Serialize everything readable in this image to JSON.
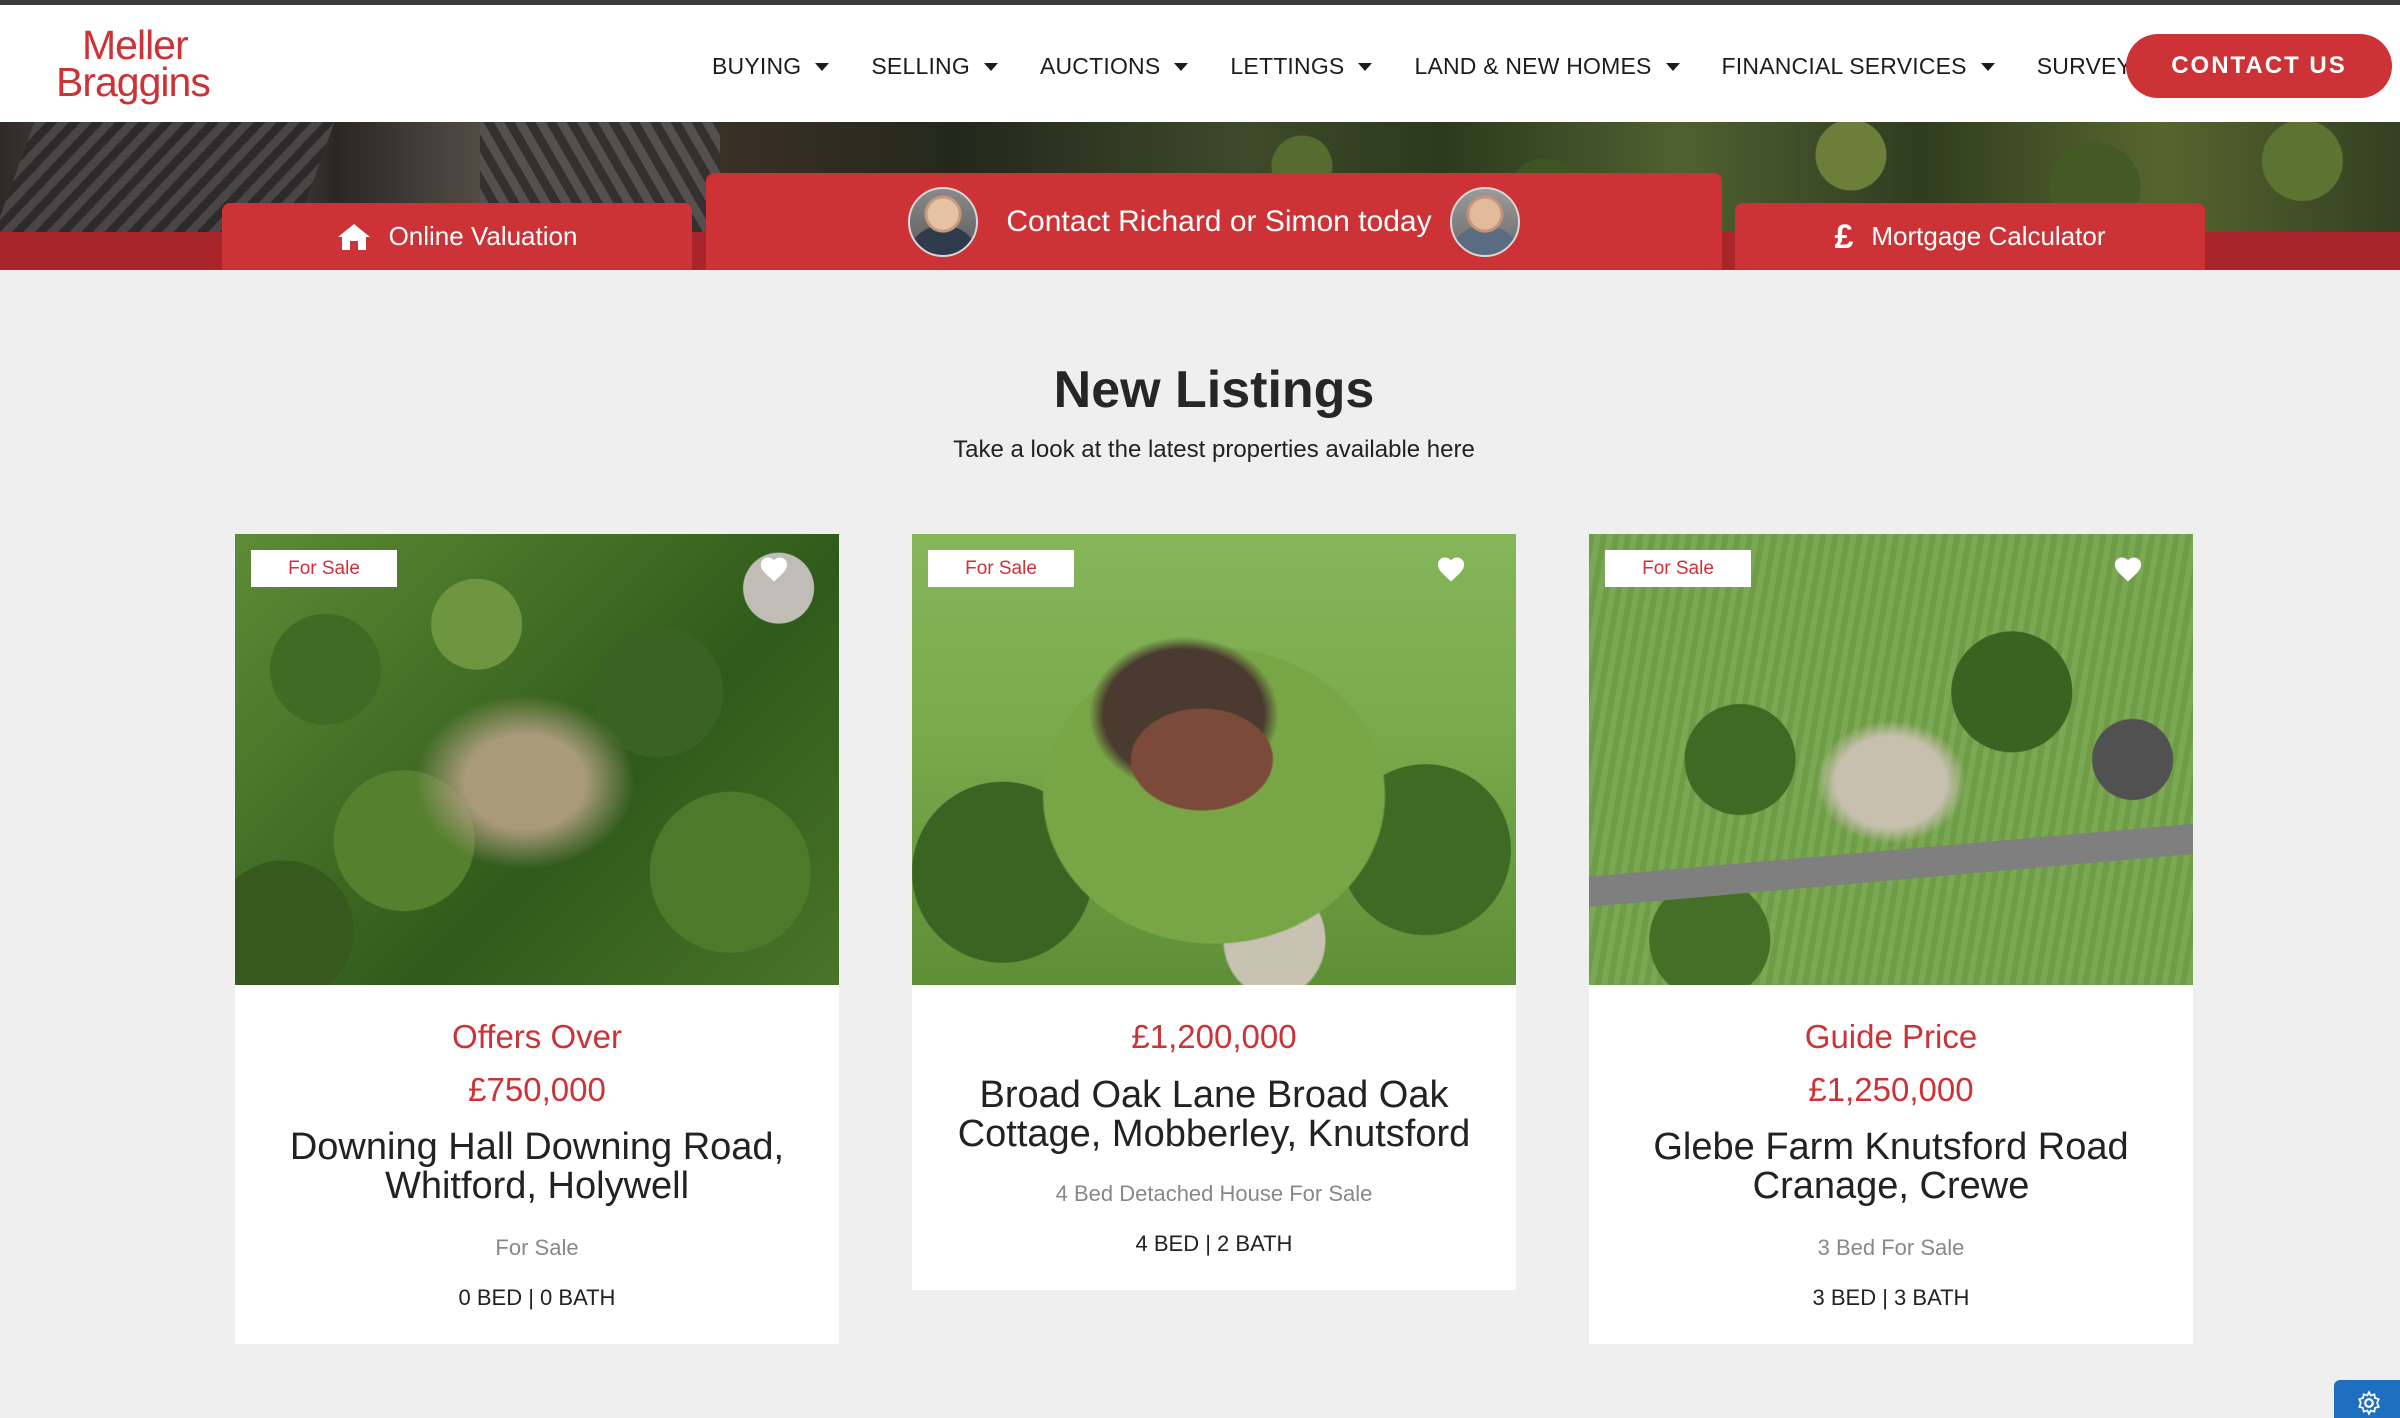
{
  "header": {
    "logo_line1": "Meller",
    "logo_line2": "Braggins",
    "nav": [
      {
        "label": "BUYING"
      },
      {
        "label": "SELLING"
      },
      {
        "label": "AUCTIONS"
      },
      {
        "label": "LETTINGS"
      },
      {
        "label": "LAND & NEW HOMES"
      },
      {
        "label": "FINANCIAL SERVICES"
      },
      {
        "label": "SURVEY"
      }
    ],
    "contact_label": "CONTACT US"
  },
  "actions": {
    "valuation_label": "Online Valuation",
    "contact_label": "Contact Richard or Simon today",
    "mortgage_label": "Mortgage Calculator",
    "mortgage_icon": "£"
  },
  "listings": {
    "title": "New Listings",
    "subtitle": "Take a look at the latest properties available here",
    "cards": [
      {
        "badge": "For Sale",
        "price_label": "Offers Over",
        "price": "£750,000",
        "address": "Downing Hall Downing Road, Whitford, Holywell",
        "description": "For Sale",
        "beds_baths": "0 BED | 0 BATH"
      },
      {
        "badge": "For Sale",
        "price_label": "",
        "price": "£1,200,000",
        "address": "Broad Oak Lane Broad Oak Cottage, Mobberley, Knutsford",
        "description": "4 Bed Detached House For Sale",
        "beds_baths": "4 BED | 2 BATH"
      },
      {
        "badge": "For Sale",
        "price_label": "Guide Price",
        "price": "£1,250,000",
        "address": "Glebe Farm Knutsford Road Cranage, Crewe",
        "description": "3 Bed For Sale",
        "beds_baths": "3 BED | 3 BATH"
      }
    ]
  },
  "colors": {
    "brand_red": "#cc3236",
    "band_red": "#a8262b",
    "background": "#efefef"
  }
}
